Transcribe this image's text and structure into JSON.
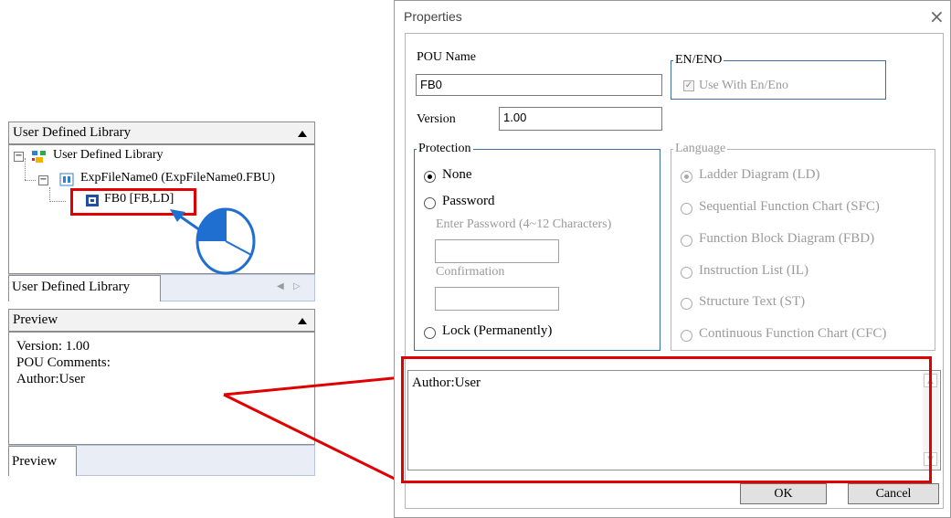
{
  "left_panel": {
    "library_header": "User Defined Library",
    "tree": {
      "root": "User Defined Library",
      "file": "ExpFileName0 (ExpFileName0.FBU)",
      "fb": "FB0 [FB,LD]"
    },
    "library_tab": "User Defined Library",
    "preview_header": "Preview",
    "preview_lines": [
      "Version: 1.00",
      "POU Comments:",
      "Author:User"
    ],
    "preview_tab": "Preview"
  },
  "dialog": {
    "title": "Properties",
    "close_glyph": "×",
    "pou_name_label": "POU Name",
    "pou_name_value": "FB0",
    "version_label": "Version",
    "version_value": "1.00",
    "en_eno": {
      "title": "EN/ENO",
      "checkbox_label": "Use With En/Eno",
      "checked": true
    },
    "protection": {
      "title": "Protection",
      "none": "None",
      "password": "Password",
      "enter_password_label": "Enter Password (4~12 Characters)",
      "confirmation_label": "Confirmation",
      "lock": "Lock (Permanently)",
      "selected": "None"
    },
    "language": {
      "title": "Language",
      "options": [
        "Ladder Diagram (LD)",
        "Sequential Function Chart (SFC)",
        "Function Block Diagram (FBD)",
        "Instruction List (IL)",
        "Structure Text (ST)",
        "Continuous Function Chart (CFC)"
      ],
      "selected": "Ladder Diagram (LD)"
    },
    "comment_text": "Author:User",
    "ok_label": "OK",
    "cancel_label": "Cancel"
  },
  "annotation": {
    "highlight_color": "#e00000",
    "arrow_color": "#1f6fd1",
    "mouse_fill": "#1f6fd1"
  }
}
